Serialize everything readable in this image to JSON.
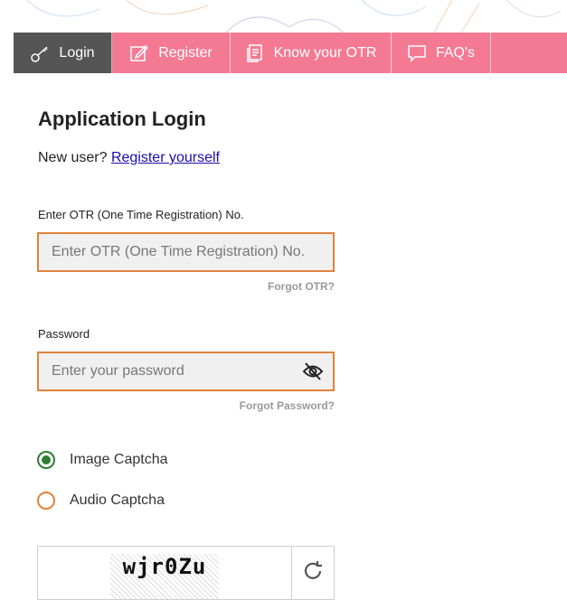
{
  "nav": {
    "tabs": [
      {
        "label": "Login",
        "icon": "key-icon",
        "active": true
      },
      {
        "label": "Register",
        "icon": "edit-icon",
        "active": false
      },
      {
        "label": "Know your OTR",
        "icon": "document-icon",
        "active": false
      },
      {
        "label": "FAQ's",
        "icon": "chat-icon",
        "active": false
      }
    ]
  },
  "form": {
    "title": "Application Login",
    "new_user_text": "New user?",
    "register_link": "Register yourself",
    "otr_label": "Enter OTR (One Time Registration) No.",
    "otr_placeholder": "Enter OTR (One Time Registration) No.",
    "forgot_otr": "Forgot OTR?",
    "password_label": "Password",
    "password_placeholder": "Enter your password",
    "forgot_password": "Forgot Password?",
    "captcha_options": [
      {
        "label": "Image Captcha",
        "checked": true
      },
      {
        "label": "Audio Captcha",
        "checked": false
      }
    ],
    "captcha_text": "wjr0Zu"
  },
  "colors": {
    "nav_bg": "#f47a94",
    "active_tab": "#555555",
    "field_border": "#e0833a",
    "radio_checked": "#2e7d32"
  }
}
